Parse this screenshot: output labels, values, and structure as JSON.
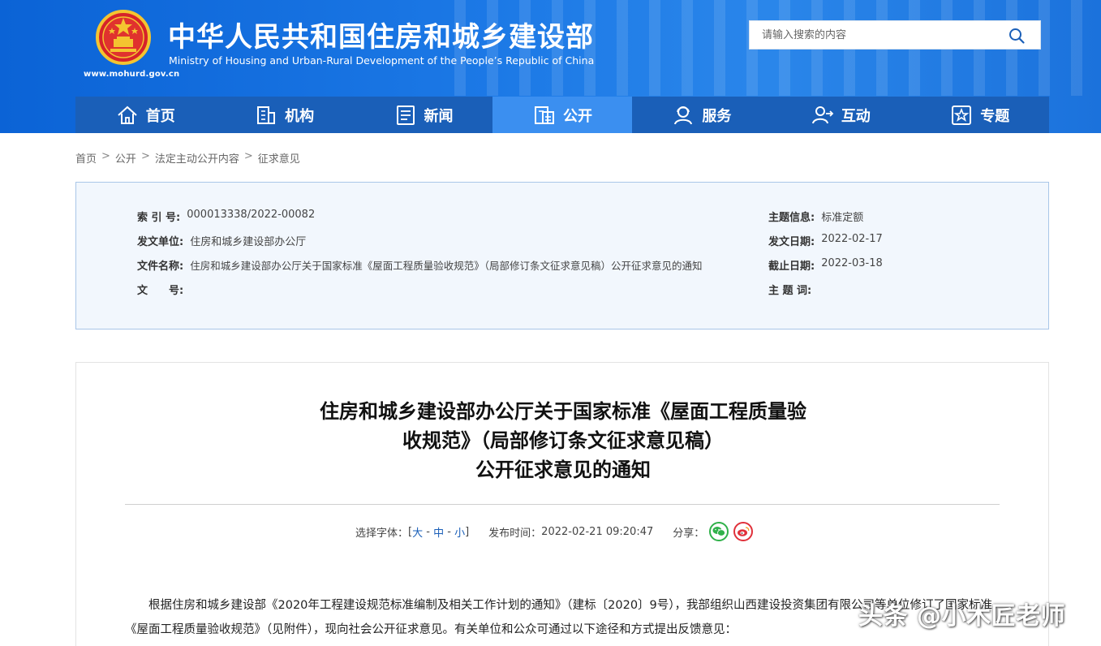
{
  "header": {
    "title": "中华人民共和国住房和城乡建设部",
    "subtitle": "Ministry of Housing and Urban-Rural Development of the People’s Republic of China",
    "url": "www.mohurd.gov.cn",
    "search_placeholder": "请输入搜索的内容"
  },
  "nav": {
    "items": [
      {
        "label": "首页",
        "icon": "home-icon"
      },
      {
        "label": "机构",
        "icon": "building-icon"
      },
      {
        "label": "新闻",
        "icon": "news-icon"
      },
      {
        "label": "公开",
        "icon": "disclosure-icon",
        "active": true
      },
      {
        "label": "服务",
        "icon": "service-icon"
      },
      {
        "label": "互动",
        "icon": "interaction-icon"
      },
      {
        "label": "专题",
        "icon": "star-icon"
      }
    ]
  },
  "breadcrumb": [
    "首页",
    "公开",
    "法定主动公开内容",
    "征求意见"
  ],
  "info": {
    "index_label": "索 引 号:",
    "index_value": "000013338/2022-00082",
    "issuer_label": "发文单位:",
    "issuer_value": "住房和城乡建设部办公厅",
    "filename_label": "文件名称:",
    "filename_value": "住房和城乡建设部办公厅关于国家标准《屋面工程质量验收规范》（局部修订条文征求意见稿）公开征求意见的通知",
    "docno_label": "文　　号:",
    "docno_value": "",
    "topic_label": "主题信息:",
    "topic_value": "标准定额",
    "date_label": "发文日期:",
    "date_value": "2022-02-17",
    "deadline_label": "截止日期:",
    "deadline_value": "2022-03-18",
    "keyword_label": "主 题 词:",
    "keyword_value": ""
  },
  "article": {
    "title_line1": "住房和城乡建设部办公厅关于国家标准《屋面工程质量验",
    "title_line2": "收规范》（局部修订条文征求意见稿）",
    "title_line3": "公开征求意见的通知",
    "font_label": "选择字体：",
    "bracket_open": "[",
    "font_large": "大",
    "dash1": " - ",
    "font_medium": "中",
    "dash2": " - ",
    "font_small": "小",
    "bracket_close": "]",
    "publish_label": "发布时间：",
    "publish_time": "2022-02-21 09:20:47",
    "share_label": "分享：",
    "paragraph": "根据住房和城乡建设部《2020年工程建设规范标准编制及相关工作计划的通知》（建标〔2020〕9号），我部组织山西建设投资集团有限公司等单位修订了国家标准《屋面工程质量验收规范》（见附件），现向社会公开征求意见。有关单位和公众可通过以下途径和方式提出反馈意见："
  },
  "watermark": "头条 @小木匠老师",
  "colors": {
    "header_blue": "#1c79e6",
    "nav_blue": "#1a5fb8",
    "nav_active": "#3b8ff0",
    "info_bg": "#f2f7fd"
  }
}
